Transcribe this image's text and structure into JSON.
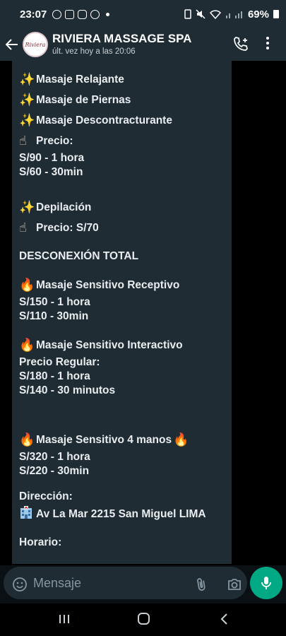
{
  "status_bar": {
    "time": "23:07",
    "battery": "69%"
  },
  "header": {
    "avatar_text": "Riviera",
    "title": "RIVIERA MASSAGE SPA",
    "subtitle": "últ. vez hoy a las 20:06"
  },
  "message": {
    "relax_services": [
      {
        "icon": "sparkles",
        "label": "Masaje Relajante"
      },
      {
        "icon": "sparkles",
        "label": "Masaje de Piernas"
      },
      {
        "icon": "sparkles",
        "label": "Masaje  Descontracturante"
      }
    ],
    "relax_price_label": "Precio:",
    "relax_prices": [
      "S/90 - 1 hora",
      "S/60 - 30min"
    ],
    "depil_service": "Depilación",
    "depil_price": "Precio:  S/70",
    "section_title": "DESCONEXIÓN TOTAL",
    "receptivo": {
      "name": "Masaje Sensitivo Receptivo",
      "prices": [
        "S/150 - 1 hora",
        "S/110 - 30min"
      ]
    },
    "interactivo": {
      "name": "Masaje Sensitivo Interactivo",
      "price_label": "Precio Regular:",
      "prices": [
        "S/180 - 1 hora",
        "S/140 - 30 minutos"
      ]
    },
    "cuatro_manos": {
      "name": "Masaje Sensitivo 4 manos",
      "prices": [
        "S/320 - 1 hora",
        "S/220 - 30min"
      ]
    },
    "address_label": "Dirección:",
    "address": "Av La Mar 2215 San Miguel LIMA",
    "hours_label": "Horario:"
  },
  "input": {
    "placeholder": "Mensaje"
  },
  "icons": {
    "emoji": "smiley-icon",
    "attach": "paperclip-icon",
    "camera": "camera-icon",
    "mic": "mic-icon"
  },
  "colors": {
    "header_bg": "#1f2c34",
    "bubble_bg": "#1f2c34",
    "accent": "#00a884"
  }
}
